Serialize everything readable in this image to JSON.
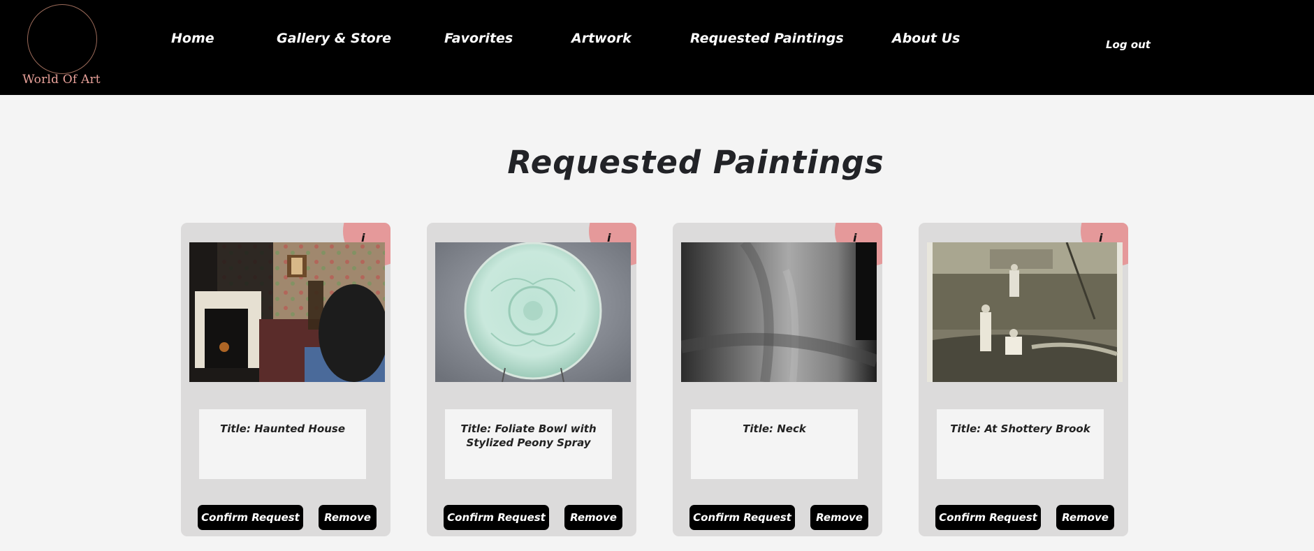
{
  "brand": {
    "name": "World Of Art"
  },
  "nav": {
    "items": [
      {
        "label": "Home"
      },
      {
        "label": "Gallery & Store"
      },
      {
        "label": "Favorites"
      },
      {
        "label": "Artwork"
      },
      {
        "label": "Requested Paintings"
      },
      {
        "label": "About Us"
      }
    ],
    "logout_label": "Log out"
  },
  "page": {
    "title": "Requested Paintings"
  },
  "cards": [
    {
      "info_label": "i",
      "title": "Title: Haunted House",
      "image_icon": "painting-interior-icon",
      "confirm_label": "Confirm Request",
      "remove_label": "Remove"
    },
    {
      "info_label": "i",
      "title": "Title: Foliate Bowl with Stylized Peony Spray",
      "image_icon": "celadon-bowl-icon",
      "confirm_label": "Confirm Request",
      "remove_label": "Remove"
    },
    {
      "info_label": "i",
      "title": "Title: Neck",
      "image_icon": "neck-photo-icon",
      "confirm_label": "Confirm Request",
      "remove_label": "Remove"
    },
    {
      "info_label": "i",
      "title": "Title: At Shottery Brook",
      "image_icon": "brook-landscape-icon",
      "confirm_label": "Confirm Request",
      "remove_label": "Remove"
    }
  ],
  "colors": {
    "header_bg": "#000000",
    "page_bg": "#f4f4f4",
    "card_bg": "#dcdbdb",
    "info_badge": "#e5999a",
    "logo_text": "#e9a29a",
    "button_bg": "#000000"
  }
}
